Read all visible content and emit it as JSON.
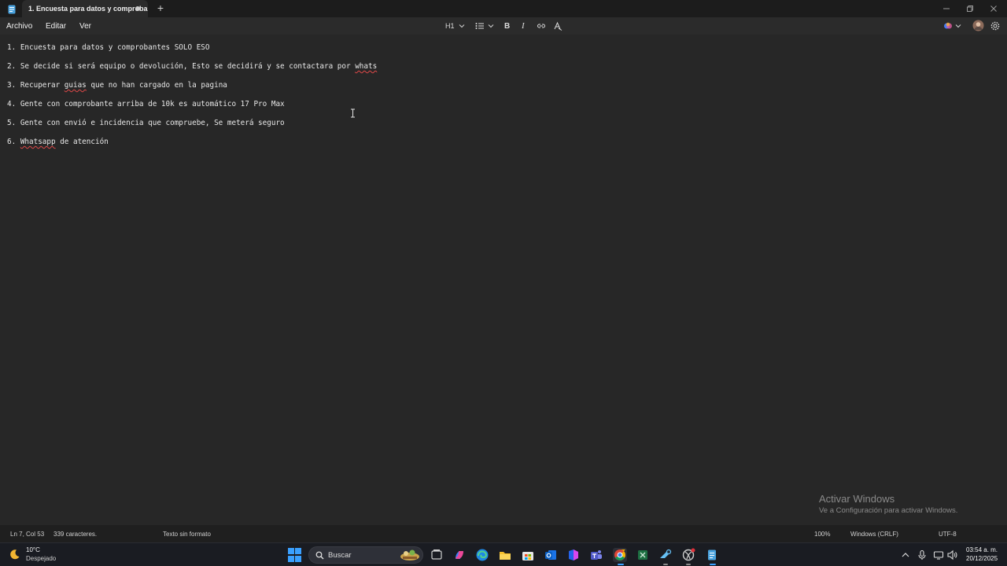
{
  "window": {
    "tab_title": "1. Encuesta para datos y comproba",
    "tab_unsaved_marker": "dot-icon",
    "new_tab": "+"
  },
  "menu": {
    "file": "Archivo",
    "edit": "Editar",
    "view": "Ver"
  },
  "toolbar": {
    "heading": "H1",
    "list": "list-icon",
    "bold": "B",
    "italic": "I",
    "link": "link-icon",
    "clear_format": "clear-format-icon",
    "copilot": "copilot-icon",
    "account": "avatar",
    "settings": "gear-icon"
  },
  "document": {
    "lines": [
      {
        "number": "1.",
        "segments": [
          {
            "text": "Encuesta para datos y comprobantes SOLO ESO",
            "misspelled": false
          }
        ]
      },
      {
        "number": "2.",
        "segments": [
          {
            "text": "Se decide si será equipo o devolución, Esto se decidirá y se contactara por ",
            "misspelled": false
          },
          {
            "text": "whats",
            "misspelled": true
          }
        ]
      },
      {
        "number": "3.",
        "segments": [
          {
            "text": "Recuperar ",
            "misspelled": false
          },
          {
            "text": "guias",
            "misspelled": true
          },
          {
            "text": " que no han cargado en la pagina",
            "misspelled": false
          }
        ]
      },
      {
        "number": "4.",
        "segments": [
          {
            "text": "Gente con comprobante arriba de 10k es automático 17 Pro Max",
            "misspelled": false
          }
        ]
      },
      {
        "number": "5.",
        "segments": [
          {
            "text": "Gente con envió e incidencia que compruebe, Se meterá seguro",
            "misspelled": false
          }
        ]
      },
      {
        "number": "6.",
        "segments": [
          {
            "text": "Whatsapp",
            "misspelled": true
          },
          {
            "text": " de atención",
            "misspelled": false
          }
        ]
      }
    ]
  },
  "watermark": {
    "title": "Activar Windows",
    "subtitle": "Ve a Configuración para activar Windows."
  },
  "status": {
    "position": "Ln 7, Col 53",
    "characters": "339 caracteres.",
    "format": "Texto sin formato",
    "zoom": "100%",
    "line_ending": "Windows (CRLF)",
    "encoding": "UTF-8"
  },
  "taskbar": {
    "weather_temp": "10°C",
    "weather_desc": "Despejado",
    "search_label": "Buscar",
    "time": "03:54 a. m.",
    "date": "20/12/2025"
  },
  "colors": {
    "accent": "#3aa0ff",
    "squiggle": "#e04848",
    "editor_bg": "#272727"
  }
}
